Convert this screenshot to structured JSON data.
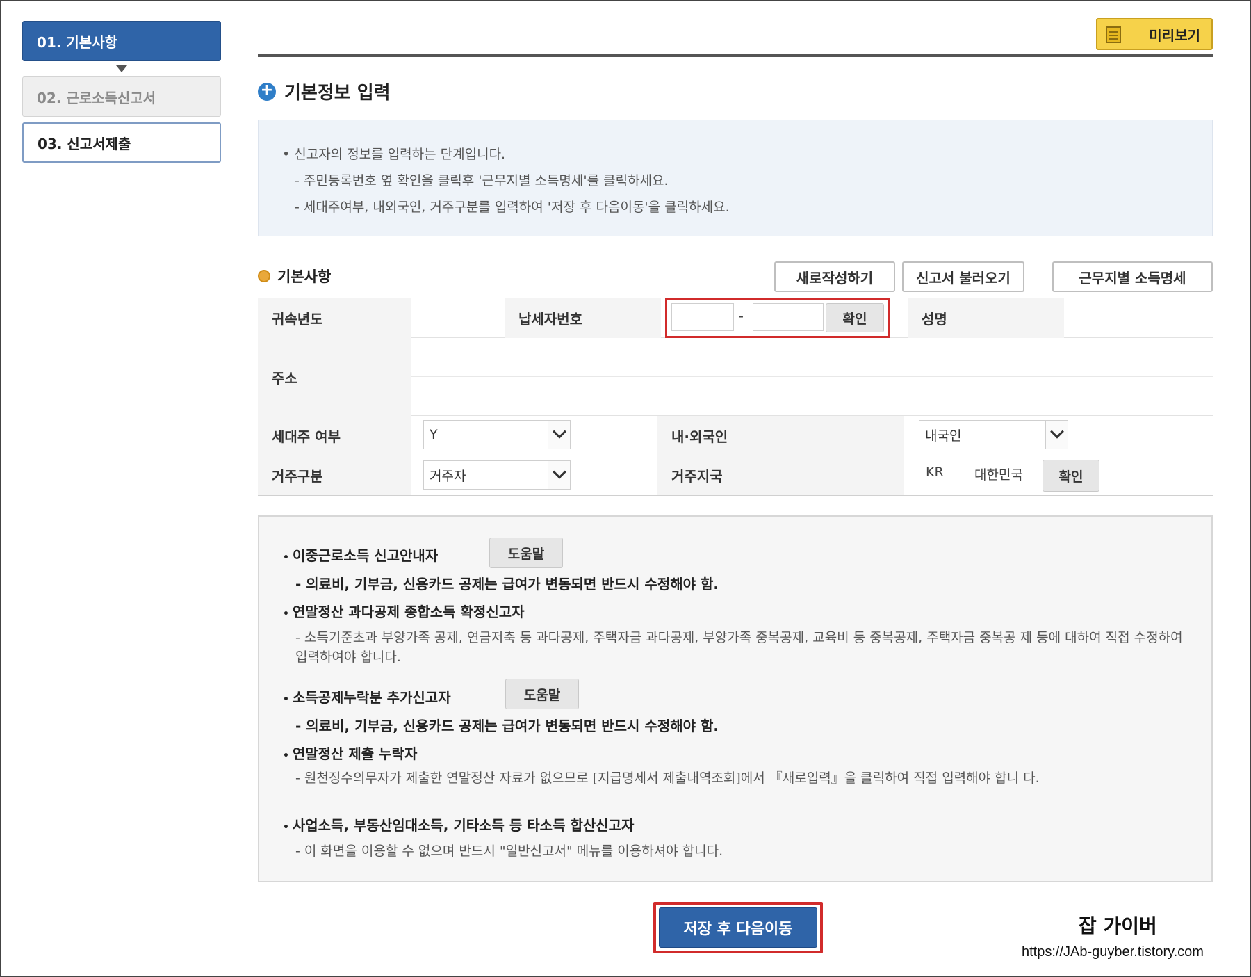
{
  "steps": [
    {
      "label": "01. 기본사항"
    },
    {
      "label": "02. 근로소득신고서"
    },
    {
      "label": "03. 신고서제출"
    }
  ],
  "preview_button": "미리보기",
  "section_title": "기본정보 입력",
  "info": {
    "line1": "• 신고자의 정보를 입력하는 단계입니다.",
    "line2": "- 주민등록번호 옆 확인을 클릭후 '근무지별 소득명세'를 클릭하세요.",
    "line3": "- 세대주여부, 내외국인, 거주구분를 입력하여 '저장 후 다음이동'을 클릭하세요."
  },
  "basic": {
    "title": "기본사항",
    "buttons": {
      "new": "새로작성하기",
      "load": "신고서 불러오기",
      "income": "근무지별 소득명세"
    }
  },
  "form": {
    "year_label": "귀속년도",
    "taxpayer_label": "납세자번호",
    "taxpayer_dash": "-",
    "confirm": "확인",
    "name_label": "성명",
    "address_label": "주소",
    "household_label": "세대주 여부",
    "household_value": "Y",
    "nationality_label": "내·외국인",
    "nationality_value": "내국인",
    "residence_label": "거주구분",
    "residence_value": "거주자",
    "country_label": "거주지국",
    "country_code": "KR",
    "country_name": "대한민국",
    "country_confirm": "확인"
  },
  "notes": {
    "h1": "이중근로소득 신고안내자",
    "help": "도움말",
    "d1": "- 의료비, 기부금, 신용카드 공제는 급여가 변동되면 반드시 수정해야 함.",
    "h2": "연말정산 과다공제 종합소득 확정신고자",
    "d2": "- 소득기준초과 부양가족 공제, 연금저축 등 과다공제, 주택자금 과다공제, 부양가족 중복공제, 교육비 등 중복공제, 주택자금 중복공 제 등에 대하여 직접 수정하여 입력하여야 합니다.",
    "h3": "소득공제누락분 추가신고자",
    "d3": "- 의료비, 기부금, 신용카드 공제는 급여가 변동되면 반드시 수정해야 함.",
    "h4": "연말정산 제출 누락자",
    "d4": "- 원천징수의무자가 제출한 연말정산 자료가 없으므로 [지급명세서 제출내역조회]에서 『새로입력』을 클릭하여 직접 입력해야 합니 다.",
    "h5": "사업소득, 부동산임대소득, 기타소득 등 타소득 합산신고자",
    "d5": "- 이 화면을 이용할 수 없으며 반드시 \"일반신고서\" 메뉴를 이용하셔야 합니다."
  },
  "save_button": "저장 후 다음이동",
  "watermark": {
    "name": "잡 가이버",
    "url": "https://JAb-guyber.tistory.com"
  },
  "colors": {
    "primary": "#2f64a8",
    "highlight": "#d12b2b",
    "preview": "#f6d24a"
  }
}
